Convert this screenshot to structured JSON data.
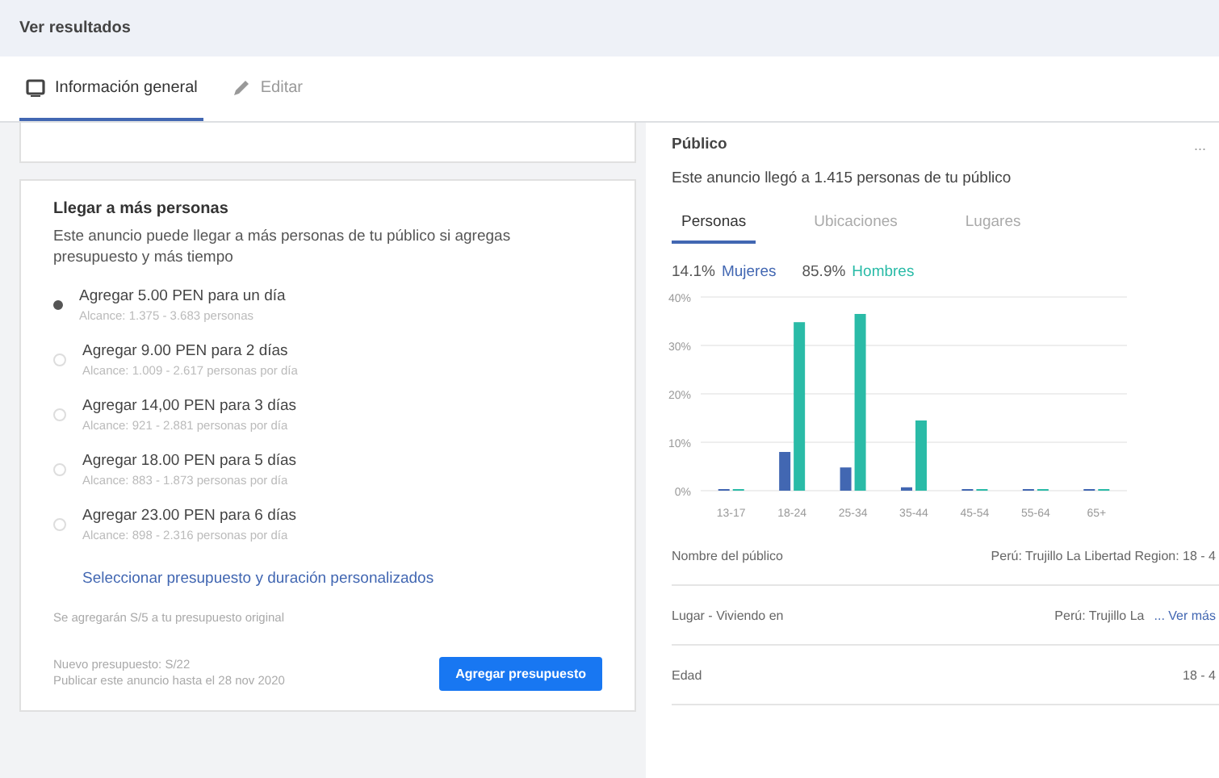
{
  "header": {
    "title": "Ver resultados"
  },
  "tabs": [
    {
      "label": "Información general",
      "kind": "overview",
      "selected": true
    },
    {
      "label": "Editar",
      "kind": "edit",
      "selected": false
    }
  ],
  "boost_card": {
    "title": "Llegar a más personas",
    "description": "Este anuncio puede llegar a más personas de tu público si agregas presupuesto y más tiempo",
    "options": [
      {
        "label": "Agregar 5.00 PEN para un día",
        "reach": "Alcance: 1.375 - 3.683 personas",
        "selected": true
      },
      {
        "label": "Agregar 9.00 PEN para 2 días",
        "reach": "Alcance: 1.009 - 2.617 personas por día",
        "selected": false
      },
      {
        "label": "Agregar 14,00 PEN para 3 días",
        "reach": "Alcance: 921 - 2.881 personas por día",
        "selected": false
      },
      {
        "label": "Agregar 18.00 PEN para 5 días",
        "reach": "Alcance: 883 - 1.873 personas por día",
        "selected": false
      },
      {
        "label": "Agregar 23.00 PEN para 6 días",
        "reach": "Alcance: 898 - 2.316 personas por día",
        "selected": false
      }
    ],
    "custom_link": "Seleccionar presupuesto y duración personalizados",
    "note": "Se agregarán S/5 a tu presupuesto original",
    "new_budget": "Nuevo presupuesto: S/22",
    "publish_until": "Publicar este anuncio hasta el 28 nov 2020",
    "button": "Agregar presupuesto"
  },
  "audience": {
    "title": "Público",
    "more": "...",
    "summary": "Este anuncio llegó a 1.415 personas de tu público",
    "tabs": [
      {
        "label": "Personas",
        "selected": true
      },
      {
        "label": "Ubicaciones",
        "selected": false
      },
      {
        "label": "Lugares",
        "selected": false
      }
    ],
    "legend": [
      {
        "percent": "14.1%"
      },
      {
        "percent": "85.9%"
      }
    ],
    "chart_data": {
      "type": "bar",
      "grid": true,
      "categories": [
        "13-17",
        "18-24",
        "25-34",
        "35-44",
        "45-54",
        "55-64",
        "65+"
      ],
      "series": [
        {
          "name": "Mujeres",
          "color": "#4267b2",
          "values": [
            0,
            8,
            4.8,
            0.7,
            0,
            0,
            0
          ]
        },
        {
          "name": "Hombres",
          "color": "#2abba7",
          "values": [
            0,
            34.8,
            36.5,
            14.5,
            0,
            0,
            0
          ]
        }
      ],
      "ylim": [
        0,
        40
      ],
      "yticks": [
        {
          "value": 0,
          "label": "0%"
        },
        {
          "value": 10,
          "label": "10%"
        },
        {
          "value": 20,
          "label": "20%"
        },
        {
          "value": 30,
          "label": "30%"
        },
        {
          "value": 40,
          "label": "40%"
        }
      ]
    },
    "details": [
      {
        "label": "Nombre del público",
        "value": "Perú: Trujillo La Libertad Region: 18 - 4"
      },
      {
        "label": "Lugar - Viviendo en",
        "value": "Perú: Trujillo La",
        "link": "... Ver más"
      },
      {
        "label": "Edad",
        "value": "18 - 4"
      }
    ]
  }
}
